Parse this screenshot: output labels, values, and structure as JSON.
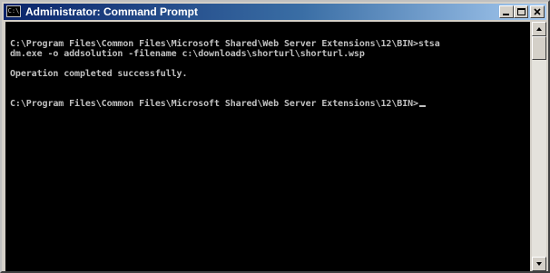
{
  "window": {
    "title": "Administrator: Command Prompt",
    "icon": "cmd-icon",
    "icon_text": "C:\\"
  },
  "caption_buttons": {
    "minimize_icon": "minimize-icon",
    "maximize_icon": "maximize-icon",
    "close_icon": "close-icon"
  },
  "console": {
    "background": "#000000",
    "text_color": "#c0c0c0",
    "lines": [
      "C:\\Program Files\\Common Files\\Microsoft Shared\\Web Server Extensions\\12\\BIN>stsa",
      "dm.exe -o addsolution -filename c:\\downloads\\shorturl\\shorturl.wsp",
      "",
      "Operation completed successfully.",
      "",
      "C:\\Program Files\\Common Files\\Microsoft Shared\\Web Server Extensions\\12\\BIN>"
    ]
  },
  "scrollbar": {
    "up_icon": "scroll-up-arrow-icon",
    "down_icon": "scroll-down-arrow-icon"
  }
}
